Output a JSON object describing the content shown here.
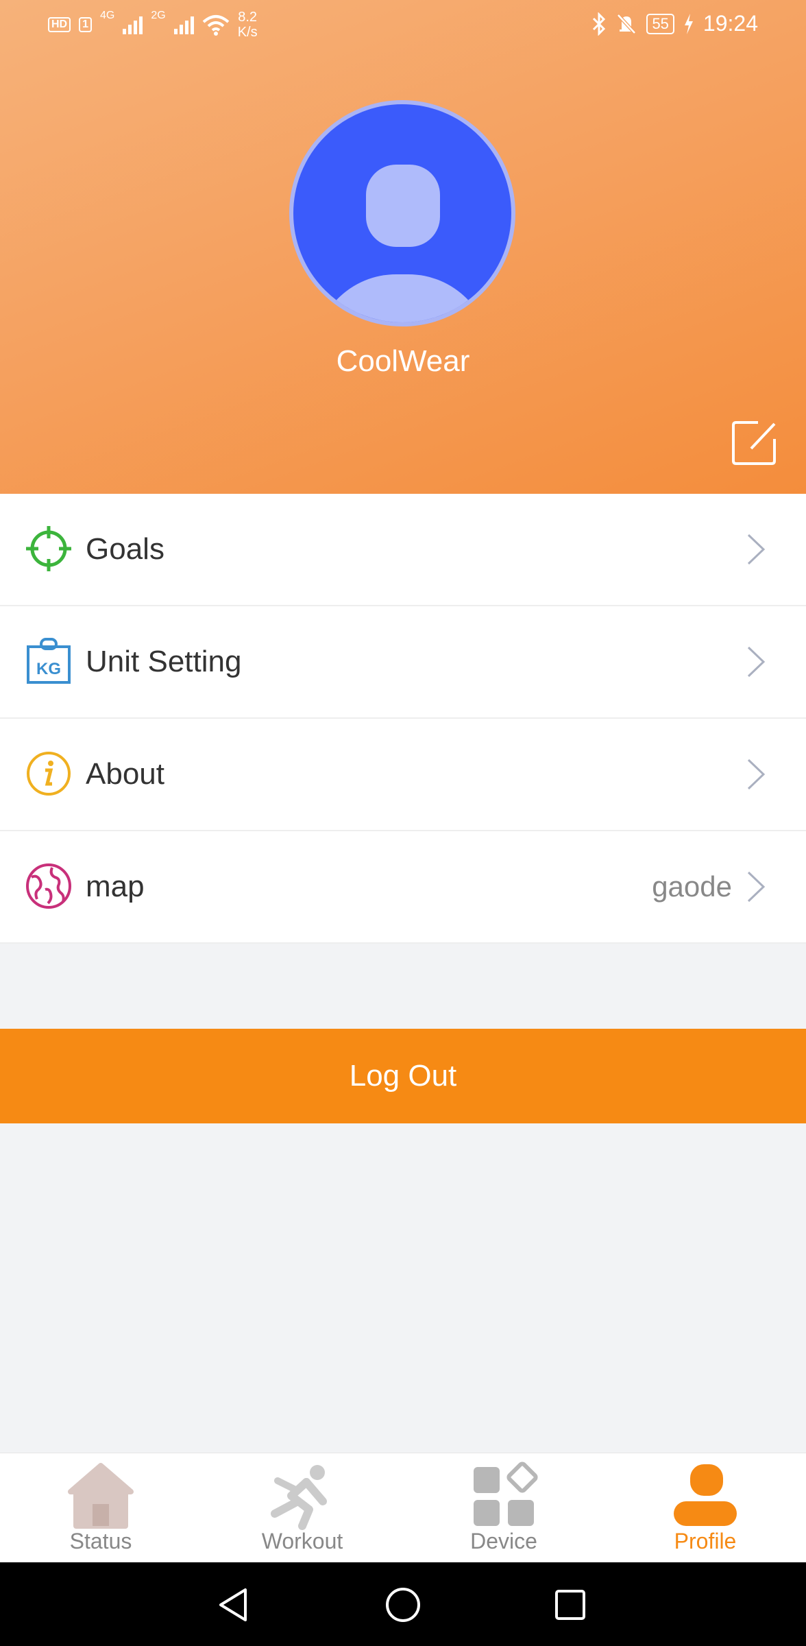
{
  "status_bar": {
    "hd": "HD",
    "sim1": "1",
    "net1": "4G",
    "net2": "2G",
    "speed_value": "8.2",
    "speed_unit": "K/s",
    "battery": "55",
    "time": "19:24"
  },
  "profile": {
    "username": "CoolWear"
  },
  "menu": [
    {
      "label": "Goals",
      "value": "",
      "icon": "target-icon"
    },
    {
      "label": "Unit Setting",
      "value": "",
      "icon": "kg-scale-icon"
    },
    {
      "label": "About",
      "value": "",
      "icon": "info-icon"
    },
    {
      "label": "map",
      "value": "gaode",
      "icon": "globe-icon"
    }
  ],
  "logout_label": "Log Out",
  "tabs": [
    {
      "label": "Status",
      "icon": "home-icon",
      "active": false
    },
    {
      "label": "Workout",
      "icon": "runner-icon",
      "active": false
    },
    {
      "label": "Device",
      "icon": "device-grid-icon",
      "active": false
    },
    {
      "label": "Profile",
      "icon": "profile-icon",
      "active": true
    }
  ],
  "colors": {
    "accent": "#f68a14",
    "header_top": "#f6b27a",
    "header_bottom": "#f48d3c",
    "avatar_bg": "#3b5bfb",
    "goals_icon": "#3cb43c",
    "unit_icon": "#3a8fd0",
    "about_icon": "#f0b020",
    "map_icon": "#c8307a"
  }
}
